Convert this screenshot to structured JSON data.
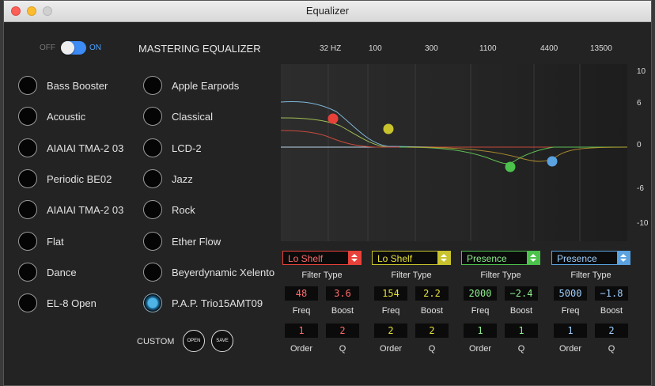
{
  "window": {
    "title": "Equalizer"
  },
  "power": {
    "off_label": "OFF",
    "on_label": "ON",
    "state": "on"
  },
  "header": {
    "title": "MASTERING EQUALIZER"
  },
  "presets_left": [
    "Bass Booster",
    "Acoustic",
    "AIAIAI TMA-2 03",
    "Periodic BE02",
    "AIAIAI TMA-2 03",
    "Flat",
    "Dance",
    "EL-8 Open"
  ],
  "presets_right": [
    "Apple Earpods",
    "Classical",
    "LCD-2",
    "Jazz",
    "Rock",
    "Ether Flow",
    "Beyerdynamic Xelento",
    "P.A.P. Trio15AMT09"
  ],
  "selected_preset": "P.A.P. Trio15AMT09",
  "custom": {
    "label": "CUSTOM",
    "open": "OPEN",
    "save": "SAVE"
  },
  "graph": {
    "freq_labels": [
      "32 HZ",
      "100",
      "300",
      "1100",
      "4400",
      "13500"
    ],
    "db_labels": [
      "10",
      "6",
      "0",
      "-6",
      "-10"
    ]
  },
  "labels": {
    "filter": "Filter",
    "type": "Type",
    "freq": "Freq",
    "boost": "Boost",
    "order": "Order",
    "q": "Q"
  },
  "bands": [
    {
      "type": "Lo Shelf",
      "freq": "48",
      "boost": "3.6",
      "order": "1",
      "q": "2",
      "color": "#e8413a",
      "value_color": "#ff6a6a"
    },
    {
      "type": "Lo Shelf",
      "freq": "154",
      "boost": "2.2",
      "order": "2",
      "q": "2",
      "color": "#c8c32c",
      "value_color": "#e6e23a"
    },
    {
      "type": "Presence",
      "freq": "2000",
      "boost": "−2.4",
      "order": "1",
      "q": "1",
      "color": "#4cc24c",
      "value_color": "#8ff08f"
    },
    {
      "type": "Presence",
      "freq": "5000",
      "boost": "−1.8",
      "order": "1",
      "q": "2",
      "color": "#5aa2e0",
      "value_color": "#9fd0ff"
    }
  ]
}
